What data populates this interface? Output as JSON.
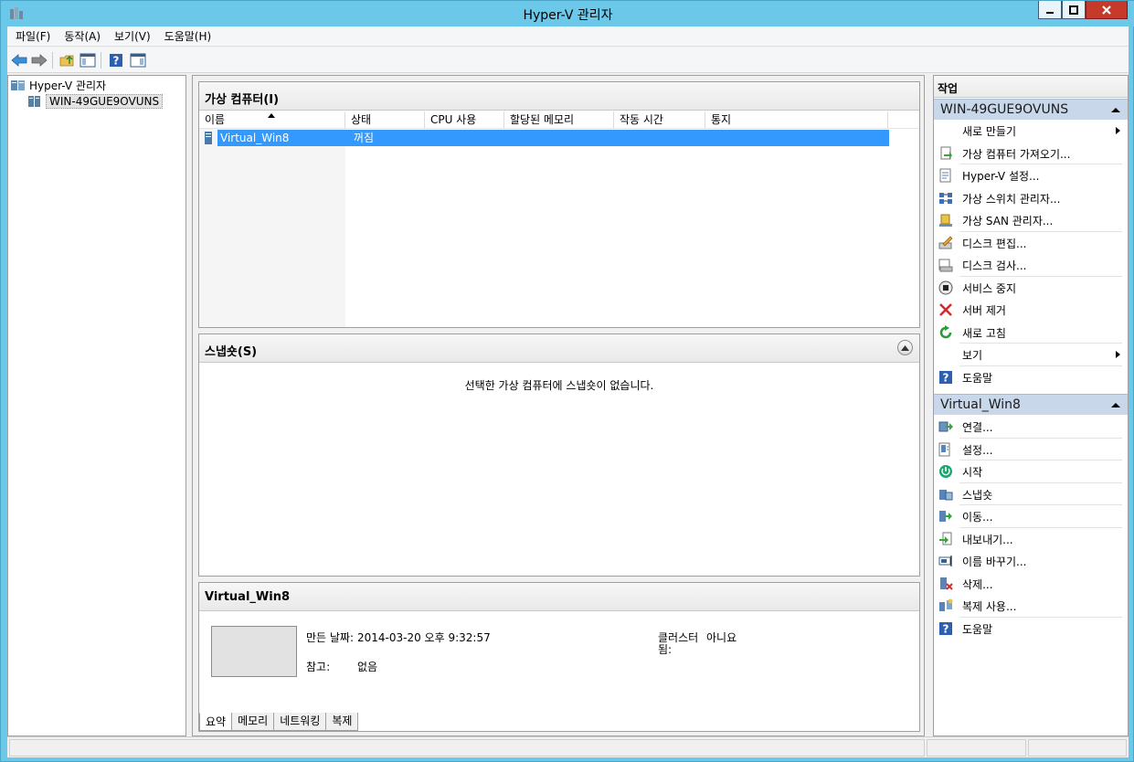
{
  "window": {
    "title": "Hyper-V 관리자"
  },
  "menubar": {
    "items": [
      "파일(F)",
      "동작(A)",
      "보기(V)",
      "도움말(H)"
    ]
  },
  "toolbar": {
    "buttons": [
      "back-arrow-icon",
      "forward-arrow-icon",
      "up-folder-icon",
      "show-hide-console-tree-icon",
      "help-icon",
      "show-hide-action-pane-icon"
    ]
  },
  "tree": {
    "root": "Hyper-V 관리자",
    "server": "WIN-49GUE9OVUNS"
  },
  "vm_panel": {
    "title": "가상 컴퓨터(I)",
    "columns": [
      "이름",
      "상태",
      "CPU 사용",
      "할당된 메모리",
      "작동 시간",
      "통지"
    ],
    "rows": [
      {
        "name": "Virtual_Win8",
        "state": "꺼짐",
        "cpu": "",
        "memory": "",
        "uptime": "",
        "status": ""
      }
    ]
  },
  "snapshot_panel": {
    "title": "스냅숏(S)",
    "empty_message": "선택한 가상 컴퓨터에 스냅숏이 없습니다."
  },
  "details_panel": {
    "title": "Virtual_Win8",
    "created_label": "만든 날짜:",
    "created_value": "2014-03-20 오후 9:32:57",
    "clustered_label_1": "클러스터",
    "clustered_label_2": "됨:",
    "clustered_value": "아니요",
    "notes_label": "참고:",
    "notes_value": "없음",
    "tabs": [
      "요약",
      "메모리",
      "네트워킹",
      "복제"
    ]
  },
  "actions": {
    "title": "작업",
    "server_section": {
      "title": "WIN-49GUE9OVUNS",
      "items": [
        {
          "label": "새로 만들기",
          "icon": "",
          "submenu": true
        },
        {
          "label": "가상 컴퓨터 가져오기...",
          "icon": "import-vm-icon"
        },
        {
          "label": "Hyper-V 설정...",
          "icon": "settings-doc-icon"
        },
        {
          "label": "가상 스위치 관리자...",
          "icon": "network-switch-icon"
        },
        {
          "label": "가상 SAN 관리자...",
          "icon": "san-icon"
        },
        {
          "label": "디스크 편집...",
          "icon": "edit-disk-icon"
        },
        {
          "label": "디스크 검사...",
          "icon": "inspect-disk-icon"
        },
        {
          "label": "서비스 중지",
          "icon": "stop-service-icon"
        },
        {
          "label": "서버 제거",
          "icon": "remove-x-icon"
        },
        {
          "label": "새로 고침",
          "icon": "refresh-icon"
        },
        {
          "label": "보기",
          "icon": "",
          "submenu": true
        },
        {
          "label": "도움말",
          "icon": "help-icon"
        }
      ]
    },
    "vm_section": {
      "title": "Virtual_Win8",
      "items": [
        {
          "label": "연결...",
          "icon": "connect-icon"
        },
        {
          "label": "설정...",
          "icon": "vm-settings-icon"
        },
        {
          "label": "시작",
          "icon": "power-start-icon"
        },
        {
          "label": "스냅숏",
          "icon": "snapshot-icon"
        },
        {
          "label": "이동...",
          "icon": "move-icon"
        },
        {
          "label": "내보내기...",
          "icon": "export-icon"
        },
        {
          "label": "이름 바꾸기...",
          "icon": "rename-icon"
        },
        {
          "label": "삭제...",
          "icon": "delete-icon"
        },
        {
          "label": "복제 사용...",
          "icon": "replication-icon"
        },
        {
          "label": "도움말",
          "icon": "help-icon"
        }
      ]
    }
  }
}
